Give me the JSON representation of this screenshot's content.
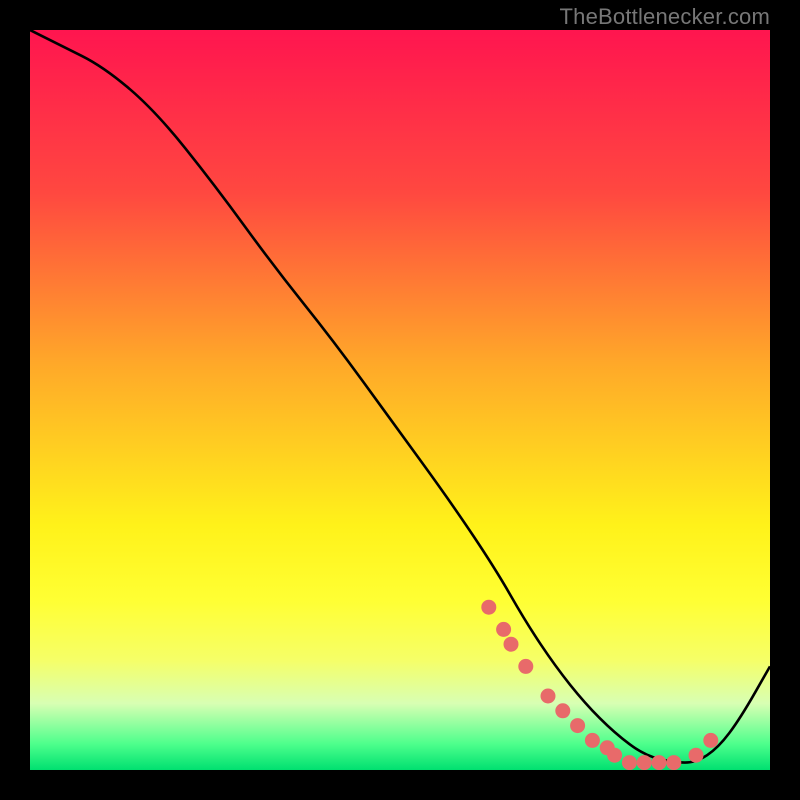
{
  "watermark": "TheBottlenecker.com",
  "chart_data": {
    "type": "line",
    "title": "",
    "xlabel": "",
    "ylabel": "",
    "xlim": [
      0,
      100
    ],
    "ylim": [
      0,
      100
    ],
    "gradient_stops": [
      {
        "offset": 0.0,
        "color": "#ff154f"
      },
      {
        "offset": 0.22,
        "color": "#ff4840"
      },
      {
        "offset": 0.45,
        "color": "#ffa829"
      },
      {
        "offset": 0.67,
        "color": "#fff21a"
      },
      {
        "offset": 0.77,
        "color": "#ffff33"
      },
      {
        "offset": 0.85,
        "color": "#f6ff66"
      },
      {
        "offset": 0.91,
        "color": "#d8ffb3"
      },
      {
        "offset": 0.965,
        "color": "#4dff8c"
      },
      {
        "offset": 1.0,
        "color": "#00e070"
      }
    ],
    "series": [
      {
        "name": "curve",
        "x": [
          0,
          4,
          10,
          17,
          25,
          33,
          41,
          49,
          57,
          63,
          67,
          71,
          75,
          79,
          83,
          87,
          90,
          93,
          96,
          100
        ],
        "y": [
          100,
          98,
          95,
          89,
          79,
          68,
          58,
          47,
          36,
          27,
          20,
          14,
          9,
          5,
          2,
          1,
          1,
          3,
          7,
          14
        ]
      }
    ],
    "marker_points": {
      "name": "dots",
      "color": "#e86a6a",
      "x": [
        62,
        64,
        65,
        67,
        70,
        72,
        74,
        76,
        78,
        79,
        81,
        83,
        85,
        87,
        90,
        92
      ],
      "y": [
        22,
        19,
        17,
        14,
        10,
        8,
        6,
        4,
        3,
        2,
        1,
        1,
        1,
        1,
        2,
        4
      ]
    }
  }
}
